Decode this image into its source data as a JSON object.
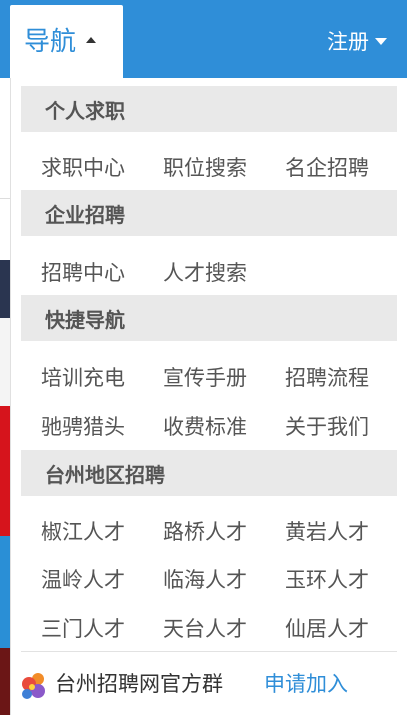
{
  "header": {
    "nav_label": "导航",
    "register_label": "注册",
    "accent_color": "#2f8ed8"
  },
  "menu": {
    "sections": [
      {
        "title": "个人求职",
        "links": [
          "求职中心",
          "职位搜索",
          "名企招聘"
        ]
      },
      {
        "title": "企业招聘",
        "links": [
          "招聘中心",
          "人才搜索"
        ]
      },
      {
        "title": "快捷导航",
        "links": [
          "培训充电",
          "宣传手册",
          "招聘流程",
          "驰骋猎头",
          "收费标准",
          "关于我们"
        ]
      },
      {
        "title": "台州地区招聘",
        "links": [
          "椒江人才",
          "路桥人才",
          "黄岩人才",
          "温岭人才",
          "临海人才",
          "玉环人才",
          "三门人才",
          "天台人才",
          "仙居人才"
        ]
      }
    ]
  },
  "footer": {
    "group_icon": "qq-group-icon",
    "group_label": "台州招聘网官方群",
    "join_label": "申请加入"
  }
}
